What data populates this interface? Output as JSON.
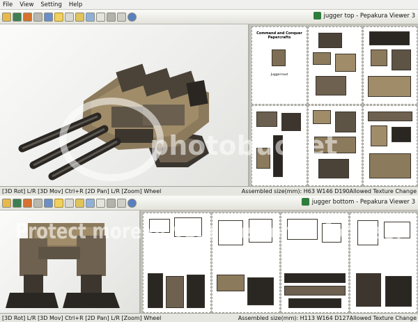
{
  "menu": [
    "File",
    "View",
    "Setting",
    "Help"
  ],
  "top_window": {
    "title": "jugger top - Pepakura Viewer 3",
    "status_left": "[3D Rot] L/R [3D Mov] Ctrl+R [2D Pan] L/R [Zoom] Wheel",
    "status_right": "Assembled size(mm): H63 W146 D190Allowed Texture Change",
    "sheet_heading": "Command and Conquer\nPapercrafts",
    "sheet_sub": "Juggernaut"
  },
  "bottom_window": {
    "title": "jugger bottom - Pepakura Viewer 3",
    "status_left": "[3D Rot] L/R [3D Mov] Ctrl+R [2D Pan] L/R [Zoom] Wheel",
    "status_right": "Assembled size(mm): H113 W164 D127Allowed Texture Change"
  },
  "watermark": {
    "text": "Protect more of your memories for less!",
    "brand": "photobucket"
  },
  "colors": {
    "accent": "#2f7d3b",
    "model_tan": "#8c7a5c",
    "model_dark": "#2a2723"
  }
}
